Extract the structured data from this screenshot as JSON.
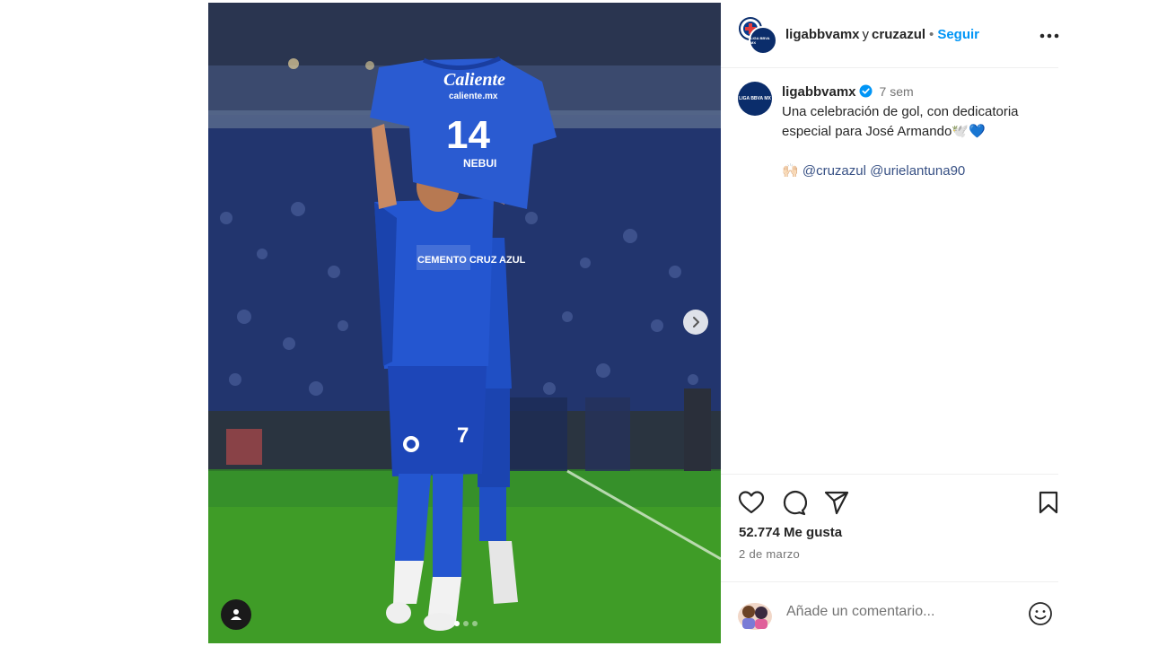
{
  "post": {
    "header": {
      "user1": "ligabbvamx",
      "joiner": "y",
      "user2": "cruzazul",
      "dot": "•",
      "follow_label": "Seguir",
      "avatar_text": "LIGA BBVA MX"
    },
    "caption": {
      "username": "ligabbvamx",
      "time": "7 sem",
      "text": "Una celebración de gol, con dedicatoria especial para José Armando🕊️💙",
      "tags_prefix": "🙌🏻",
      "mention1": "@cruzazul",
      "mention2": "@urielantuna90"
    },
    "likes": "52.774 Me gusta",
    "date": "2 de marzo",
    "comment": {
      "placeholder": "Añade un comentario..."
    },
    "media": {
      "jersey_sponsor": "Caliente",
      "jersey_sponsor_sub": "caliente.mx",
      "jersey_number": "14",
      "jersey_name": "NEBUI",
      "shirt_sponsor": "CEMENTO CRUZ AZUL",
      "player_number": "7",
      "carousel_total": 3,
      "carousel_active": 1
    }
  },
  "colors": {
    "accent": "#0095f6",
    "mention": "#385185",
    "verified": "#0095f6",
    "kit_blue": "#1f4fc4",
    "grass": "#3f9c27"
  },
  "icons": {
    "like": "heart-icon",
    "comment": "comment-icon",
    "share": "send-icon",
    "save": "bookmark-icon",
    "more": "more-options-icon",
    "next": "chevron-right-icon",
    "tag": "user-tag-icon",
    "emoji": "smiley-icon"
  }
}
